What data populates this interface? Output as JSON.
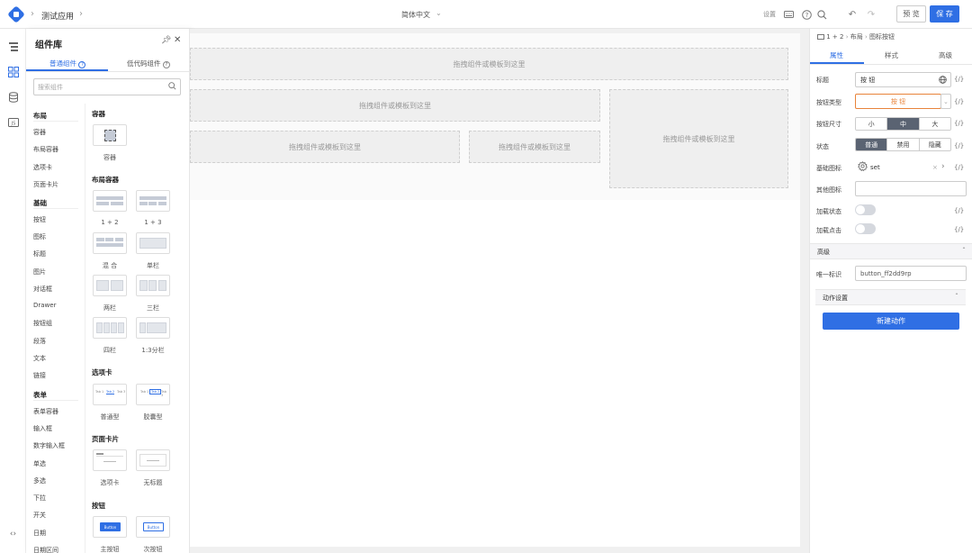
{
  "header": {
    "app_name": "测试应用",
    "language": "简体中文",
    "settings_label": "设置",
    "preview_label": "预 览",
    "save_label": "保 存",
    "brand_color": "#2f6fe4"
  },
  "library": {
    "title": "组件库",
    "tabs": [
      "普通组件",
      "低代码组件"
    ],
    "search_placeholder": "搜索组件",
    "categories": [
      {
        "heading": "布局",
        "items": [
          "容器",
          "布局容器",
          "选项卡",
          "页面卡片"
        ]
      },
      {
        "heading": "基础",
        "items": [
          "按钮",
          "图标",
          "标题",
          "图片",
          "对话框",
          "Drawer",
          "按钮组",
          "段落",
          "文本",
          "链接"
        ]
      },
      {
        "heading": "表单",
        "items": [
          "表单容器",
          "输入框",
          "数字输入框",
          "单选",
          "多选",
          "下拉",
          "开关",
          "日期",
          "日期区间"
        ]
      }
    ],
    "groups": {
      "container": {
        "heading": "容器",
        "items": [
          "容器"
        ]
      },
      "layout": {
        "heading": "布局容器",
        "items": [
          "1 + 2",
          "1 + 3",
          "混 合",
          "单栏",
          "两栏",
          "三栏",
          "四栏",
          "1:3分栏"
        ]
      },
      "tabs": {
        "heading": "选项卡",
        "items": [
          "普通型",
          "胶囊型"
        ],
        "mini_tab_labels": [
          "Tab 1",
          "Tab 2",
          "Tab 3"
        ]
      },
      "cards": {
        "heading": "页面卡片",
        "items": [
          "选项卡",
          "无标题"
        ]
      },
      "buttons": {
        "heading": "按钮",
        "items": [
          "主按钮",
          "次按钮"
        ],
        "sample_text": "Button"
      }
    }
  },
  "canvas": {
    "drop_hint": "拖拽组件或模板到这里"
  },
  "props": {
    "breadcrumb": [
      "1 + 2",
      "布局",
      "图标按钮"
    ],
    "tabs": [
      "属性",
      "样式",
      "高级"
    ],
    "bind_label": "{/}",
    "rows": {
      "title": {
        "label": "标题",
        "value": "按 钮"
      },
      "btn_type": {
        "label": "按钮类型",
        "value": "按 钮"
      },
      "btn_size": {
        "label": "按钮尺寸",
        "options": [
          "小",
          "中",
          "大"
        ],
        "selected": "中"
      },
      "state": {
        "label": "状态",
        "options": [
          "普通",
          "禁用",
          "隐藏"
        ],
        "selected": "普通"
      },
      "base_icon": {
        "label": "基础图标",
        "value": "set",
        "clear": "×"
      },
      "other_icon": {
        "label": "其他图标"
      },
      "loading_state": {
        "label": "加载状态"
      },
      "loading_click": {
        "label": "加载点击"
      }
    },
    "advanced": {
      "heading": "高级",
      "uid_label": "唯一标识",
      "uid_value": "button_ff2dd9rp"
    },
    "actions": {
      "heading": "动作设置",
      "new_action_label": "新建动作"
    },
    "highlight_color": "#e8833a"
  }
}
